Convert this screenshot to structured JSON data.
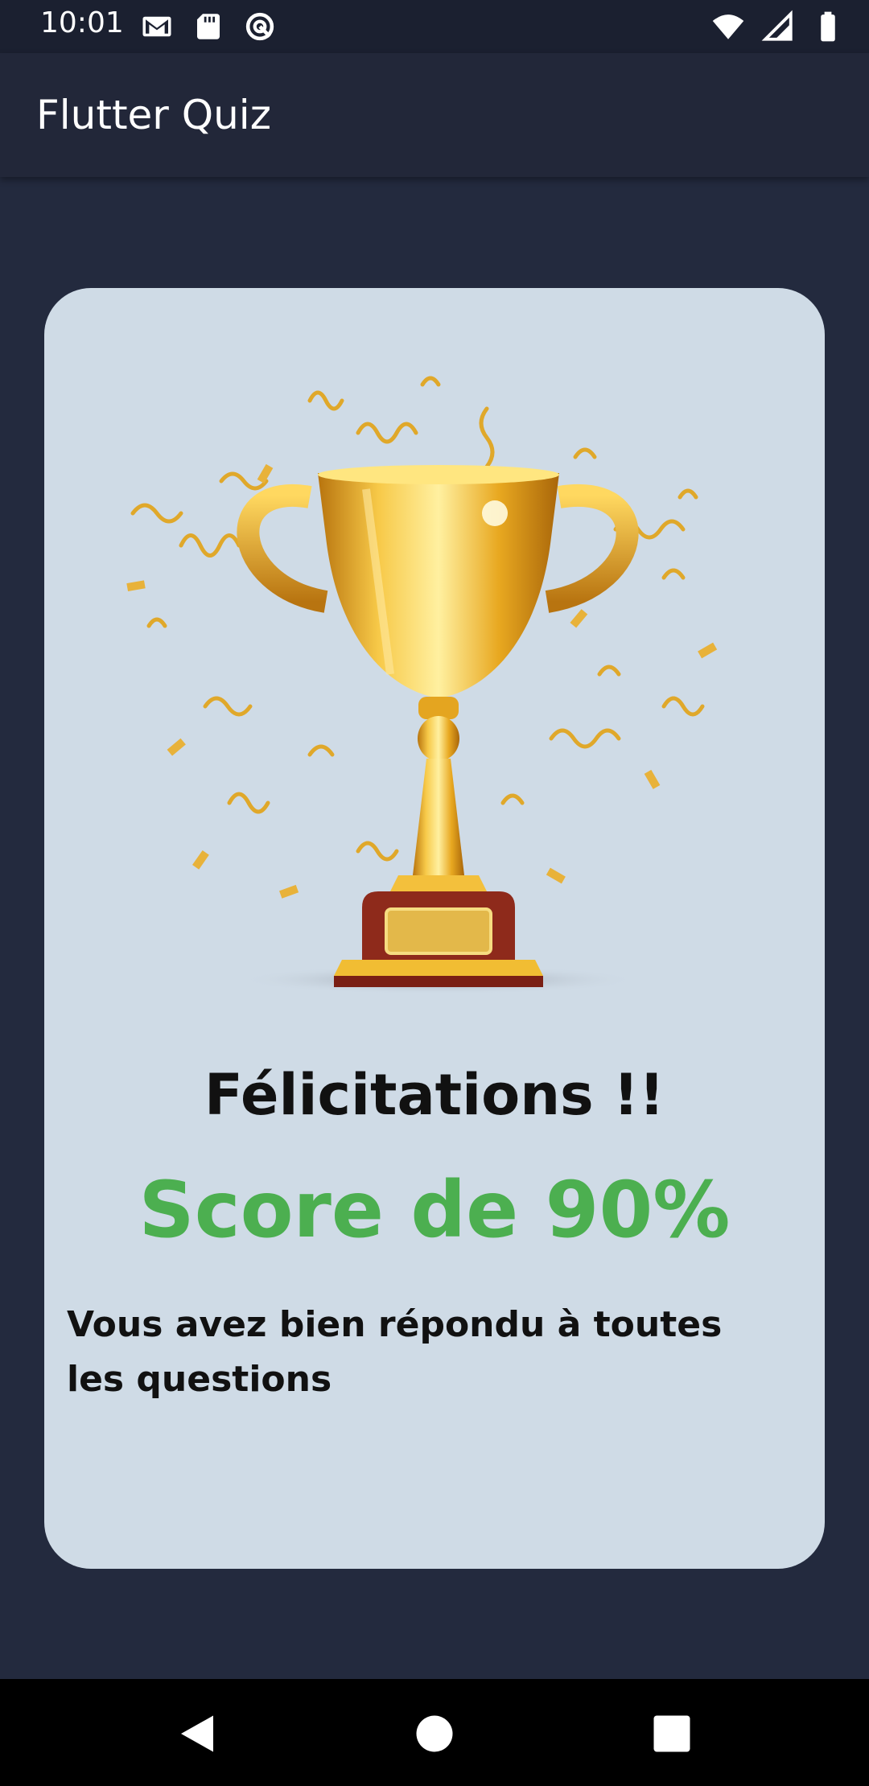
{
  "status_bar": {
    "time": "10:01",
    "left_icons": [
      "gmail-icon",
      "sd-card-icon",
      "data-saver-icon"
    ],
    "right_icons": [
      "wifi-icon",
      "signal-icon",
      "battery-icon"
    ]
  },
  "app_bar": {
    "title": "Flutter Quiz"
  },
  "result_card": {
    "image": "trophy-with-confetti",
    "congrats": "Félicitations !!",
    "score": "Score de 90%",
    "score_color": "#4caf50",
    "message": "Vous avez bien répondu à toutes les questions"
  },
  "nav_bar": {
    "buttons": [
      "back-icon",
      "home-icon",
      "recents-icon"
    ]
  },
  "colors": {
    "background": "#232a3e",
    "card": "#cfdbe6",
    "gold": "#e8b020"
  }
}
